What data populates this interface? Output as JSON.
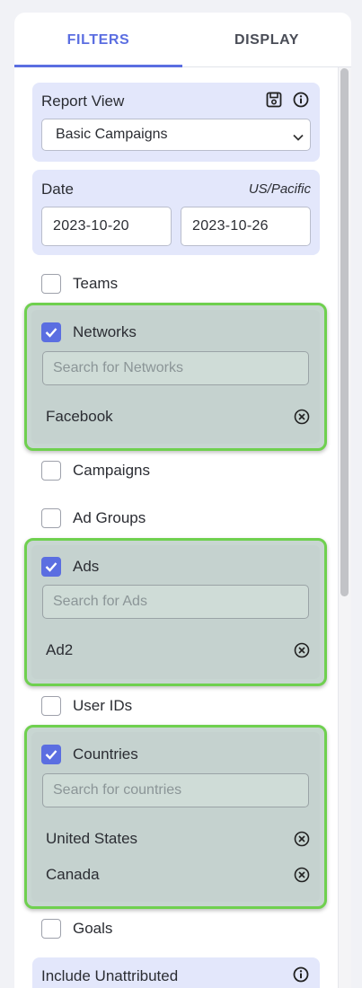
{
  "tabs": [
    {
      "label": "FILTERS"
    },
    {
      "label": "DISPLAY"
    }
  ],
  "report_view": {
    "title": "Report View",
    "selected": "Basic Campaigns",
    "icons": [
      "save-icon",
      "info-icon"
    ]
  },
  "date": {
    "title": "Date",
    "timezone": "US/Pacific",
    "start": "2023-10-20",
    "end": "2023-10-26"
  },
  "filters": {
    "teams": {
      "label": "Teams",
      "checked": false
    },
    "networks": {
      "label": "Networks",
      "checked": true,
      "placeholder": "Search for Networks",
      "items": [
        "Facebook"
      ]
    },
    "campaigns": {
      "label": "Campaigns",
      "checked": false
    },
    "ad_groups": {
      "label": "Ad Groups",
      "checked": false
    },
    "ads": {
      "label": "Ads",
      "checked": true,
      "placeholder": "Search for Ads",
      "items": [
        "Ad2"
      ]
    },
    "user_ids": {
      "label": "User IDs",
      "checked": false
    },
    "countries": {
      "label": "Countries",
      "checked": true,
      "placeholder": "Search for countries",
      "items": [
        "United States",
        "Canada"
      ]
    },
    "goals": {
      "label": "Goals",
      "checked": false
    }
  },
  "include_unattributed": {
    "label": "Include Unattributed"
  },
  "colors": {
    "accent": "#5b6ee1",
    "highlight": "#6fd04f",
    "card": "#e3e7fb"
  }
}
